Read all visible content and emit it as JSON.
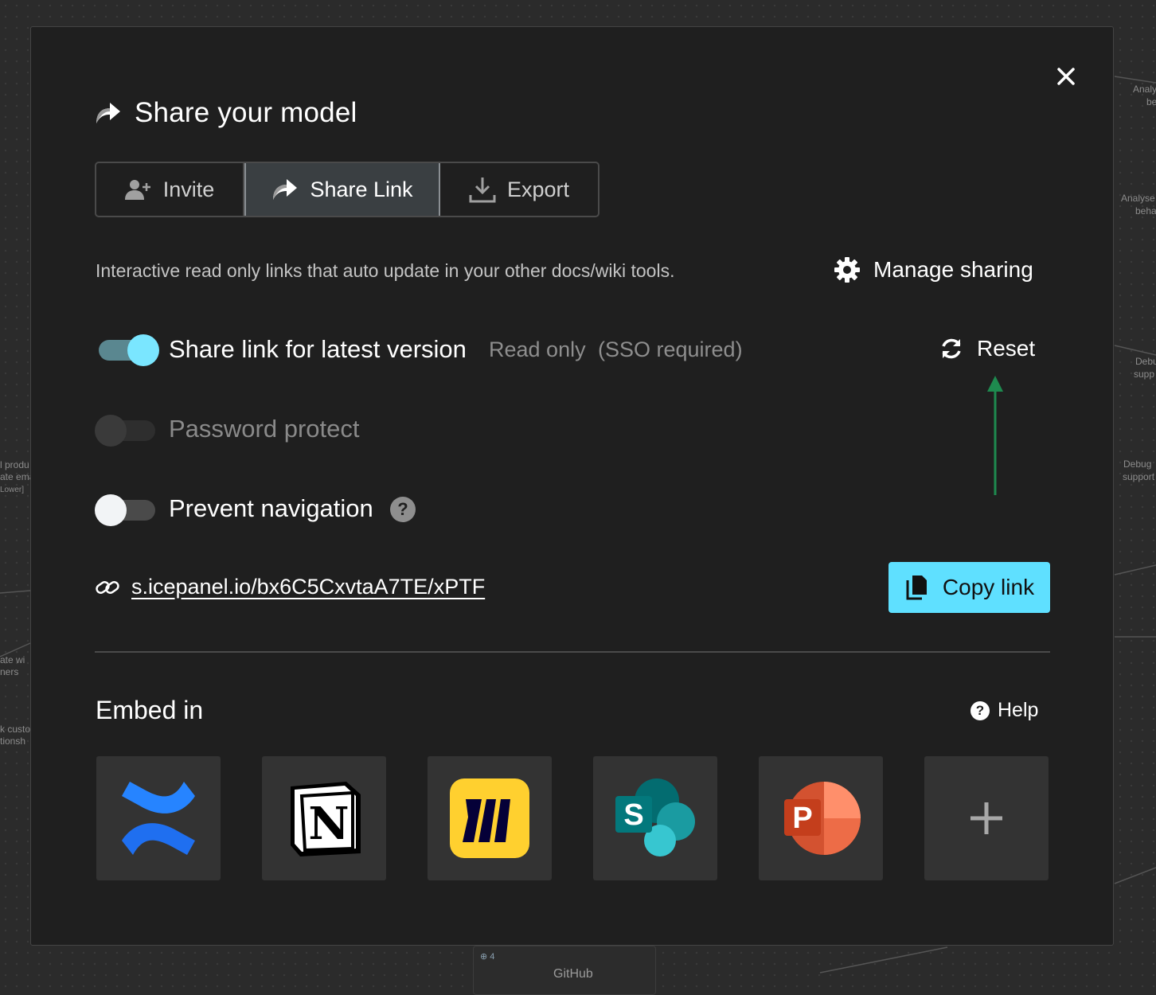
{
  "background": {
    "fragments": [
      "Analy",
      "be",
      "Analyse",
      "beha",
      "Debu",
      "supp",
      "Debug",
      "support",
      "l produ",
      "ate ema",
      "Lower]",
      "ate wi",
      "ners",
      "k custo",
      "tionsh"
    ],
    "card_badge": "4",
    "card_label": "GitHub"
  },
  "modal": {
    "title": "Share your model",
    "tabs": [
      {
        "label": "Invite",
        "icon": "add-user-icon",
        "active": false
      },
      {
        "label": "Share Link",
        "icon": "share-icon",
        "active": true
      },
      {
        "label": "Export",
        "icon": "download-icon",
        "active": false
      }
    ],
    "description": "Interactive read only links that auto update in your other docs/wiki tools.",
    "manage_sharing": "Manage sharing",
    "share_latest": {
      "label": "Share link for latest version",
      "read_only": "Read only",
      "sso": "(SSO required)",
      "enabled": true
    },
    "reset": "Reset",
    "password_protect": {
      "label": "Password protect",
      "enabled": false,
      "disabled": true
    },
    "prevent_navigation": {
      "label": "Prevent navigation",
      "enabled": false,
      "help": "?"
    },
    "link": "s.icepanel.io/bx6C5CxvtaA7TE/xPTF",
    "copy_link": "Copy link",
    "embed_title": "Embed in",
    "help": "Help",
    "help_glyph": "?",
    "embed_tiles": [
      {
        "name": "confluence",
        "icon": "confluence-icon"
      },
      {
        "name": "notion",
        "icon": "notion-icon",
        "glyph": "N"
      },
      {
        "name": "miro",
        "icon": "miro-icon"
      },
      {
        "name": "sharepoint",
        "icon": "sharepoint-icon",
        "glyph": "S"
      },
      {
        "name": "powerpoint",
        "icon": "powerpoint-icon",
        "glyph": "P"
      },
      {
        "name": "more",
        "icon": "plus-icon"
      }
    ],
    "colors": {
      "accent": "#5fe0ff",
      "annotation_arrow": "#1e8a4f",
      "modal_bg": "#1f1f1f"
    }
  }
}
